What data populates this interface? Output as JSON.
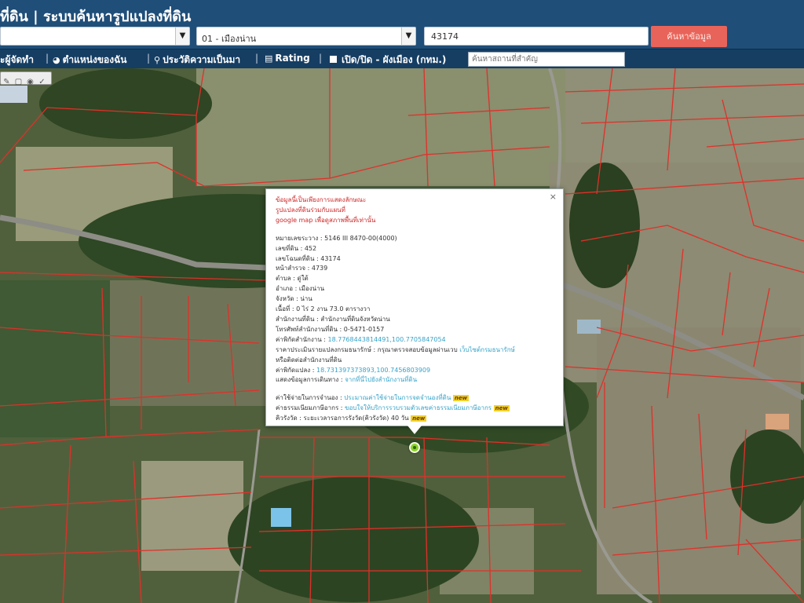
{
  "header": {
    "title": "ที่ดิน | ระบบค้นหารูปแปลงที่ดิน",
    "province_select": "",
    "district_select": "01 - เมืองน่าน",
    "parcel_input": "43174",
    "search_button": "ค้นหาข้อมูล",
    "dropdown_arrow": "▼"
  },
  "toolbar": {
    "item_manager": "ะผู้จัดทำ",
    "item_location": "ตำแหน่งของฉัน",
    "item_history": "ประวัติความเป็นมา",
    "item_rating": "Rating",
    "item_toggle": "เปิด/ปิด - ผังเมือง (กทม.)",
    "separator": "|",
    "place_search_placeholder": "ค้นหาสถานที่สำคัญ"
  },
  "map_tools": [
    "✎",
    "▢",
    "◉",
    "✓"
  ],
  "popup": {
    "close": "×",
    "warning_lines": [
      "ข้อมูลนี้เป็นเพียงการแสดงลักษณะ",
      "รูปแปลงที่ดินร่วมกับแผนที่",
      "google map เพื่อดูสภาพพื้นที่เท่านั้น"
    ],
    "map_sheet": "หมายเลขระวาง : 5146 III 8470-00(4000)",
    "land_no": "เลขที่ดิน : 452",
    "deed_no": "เลขโฉนดที่ดิน : 43174",
    "survey_page": "หน้าสำรวจ : 4739",
    "subdistrict": "ตำบล : ดู่ใต้",
    "district": "อำเภอ : เมืองน่าน",
    "province": "จังหวัด : น่าน",
    "area": "เนื้อที่ : 0 ไร่ 2 งาน 73.0 ตารางวา",
    "office": "สำนักงานที่ดิน : สำนักงานที่ดินจังหวัดน่าน",
    "phone": "โทรศัพท์สำนักงานที่ดิน : 0-5471-0157",
    "office_coords_label": "ค่าพิกัดสำนักงาน : ",
    "office_coords": "18.7768443814491,100.7705847054",
    "appraisal_label": "ราคาประเมินรายแปลงกรมธนารักษ์ : กรุณาตรวจสอบข้อมูลผ่านเวบ ",
    "appraisal_link": "เว็บไซต์กรมธนารักษ์",
    "appraisal_tail": "หรือติดต่อสำนักงานที่ดิน",
    "parcel_coords_label": "ค่าพิกัดแปลง : ",
    "parcel_coords": "18.731397373893,100.7456803909",
    "route_label": "แสดงข้อมูลการเดินทาง : ",
    "route_link": "จากที่นี่ไปยังสำนักงานที่ดิน",
    "fee_label": "ค่าใช้จ่ายในการจำนอง : ",
    "fee_link": "ประมาณค่าใช้จ่ายในการจดจำนองที่ดิน",
    "tax_label": "ค่าธรรมเนียมภาษีอากร : ",
    "tax_link": "ขอบใจให้บริการรวบรวมตัวเลขค่าธรรมเนียมภาษีอากร",
    "queue_label": "คิวรังวัด : ระยะเวลารอการรังวัด(คิวรังวัด) 40 วัน",
    "new_badge": "new"
  },
  "colors": {
    "header_bg": "#1f4e79",
    "toolbar_bg": "#163e63",
    "search_button": "#e8645a",
    "parcel_lines": "#e0302a",
    "warning_text": "#d02525",
    "link_text": "#36a3c9"
  },
  "icons": [
    "dropdown-arrow-icon",
    "location-icon",
    "history-icon",
    "rating-icon",
    "toggle-square-icon",
    "close-icon",
    "map-marker-icon"
  ]
}
